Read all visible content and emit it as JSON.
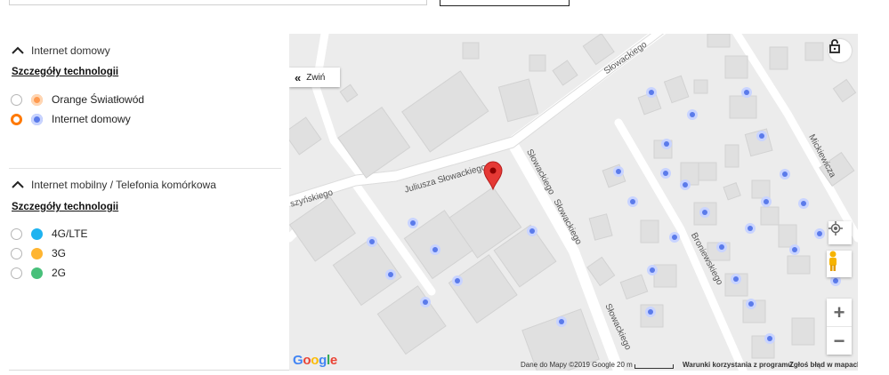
{
  "layers": {
    "internet_domowy": {
      "header": "Internet domowy",
      "details_link": "Szczegóły technologii",
      "options": [
        {
          "label": "Orange Światłowód",
          "color": "#ff9a50",
          "selected": false
        },
        {
          "label": "Internet domowy",
          "color": "#5b7bea",
          "selected": true
        }
      ]
    },
    "internet_mobilny": {
      "header": "Internet mobilny / Telefonia komórkowa",
      "details_link": "Szczegóły technologii",
      "options": [
        {
          "label": "4G/LTE",
          "color": "#1fb3f0",
          "selected": false
        },
        {
          "label": "3G",
          "color": "#ffb531",
          "selected": false
        },
        {
          "label": "2G",
          "color": "#48c07a",
          "selected": false
        }
      ]
    }
  },
  "map": {
    "collapse_label": "Zwiń",
    "streets": {
      "slowackiego_top": "Słowackiego",
      "juliusza": "Juliusza Słowackiego",
      "slowackiego_mid": "Słowackiego",
      "slowackiego_lower": "Słowackiego",
      "slowackiego_bottom": "Słowackiego",
      "mickiewicza": "Mickiewicza",
      "broniewskiego": "Broniewskiego",
      "szynskiego": "szyńskiego"
    },
    "attribution": {
      "data": "Dane do Mapy ©2019 Google",
      "scale": "20 m",
      "terms": "Warunki korzystania z programu",
      "report": "Zgłoś błąd w mapach"
    },
    "logo": "Google",
    "accent": "#ff7900",
    "marker_color": "#e53935",
    "coverage_dot_color": "#5b7bea"
  }
}
